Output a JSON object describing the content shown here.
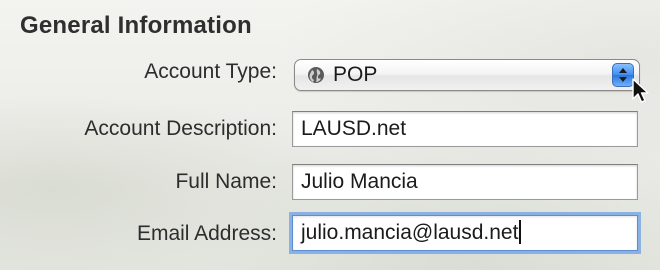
{
  "section": {
    "title": "General Information"
  },
  "form": {
    "account_type": {
      "label": "Account Type:",
      "value": "POP",
      "icon": "globe-icon"
    },
    "account_description": {
      "label": "Account Description:",
      "value": "LAUSD.net"
    },
    "full_name": {
      "label": "Full Name:",
      "value": "Julio Mancia"
    },
    "email_address": {
      "label": "Email Address:",
      "value": "julio.mancia@lausd.net"
    }
  },
  "colors": {
    "focus_ring": "#6ea0e6",
    "stepper_accent": "#3e8df2"
  }
}
